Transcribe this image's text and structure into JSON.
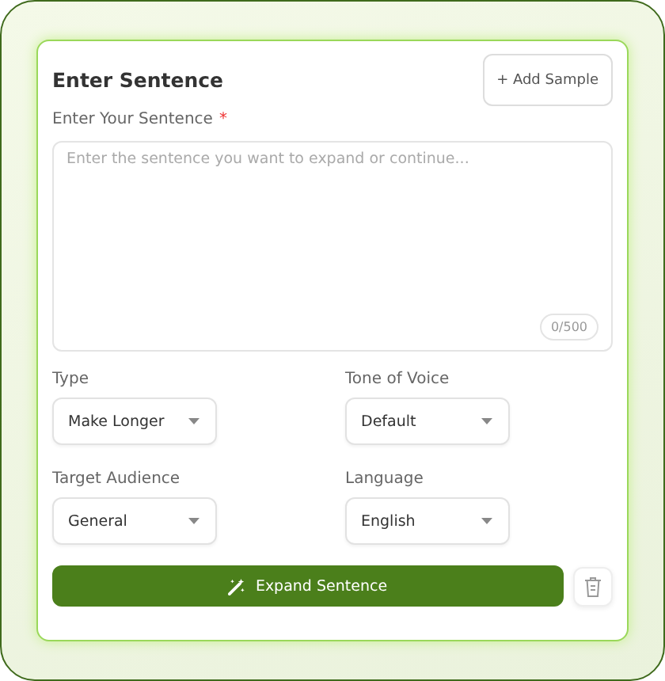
{
  "card": {
    "title": "Enter Sentence",
    "add_button": "+ Add Sample"
  },
  "sentence": {
    "label": "Enter Your Sentence",
    "required_mark": "*",
    "placeholder": "Enter the sentence you want to expand or continue...",
    "counter": "0/500"
  },
  "selects": [
    {
      "label": "Type",
      "value": "Make Longer"
    },
    {
      "label": "Tone of Voice",
      "value": "Default"
    },
    {
      "label": "Target Audience",
      "value": "General"
    },
    {
      "label": "Language",
      "value": "English"
    }
  ],
  "submit_button": "Expand Sentence"
}
